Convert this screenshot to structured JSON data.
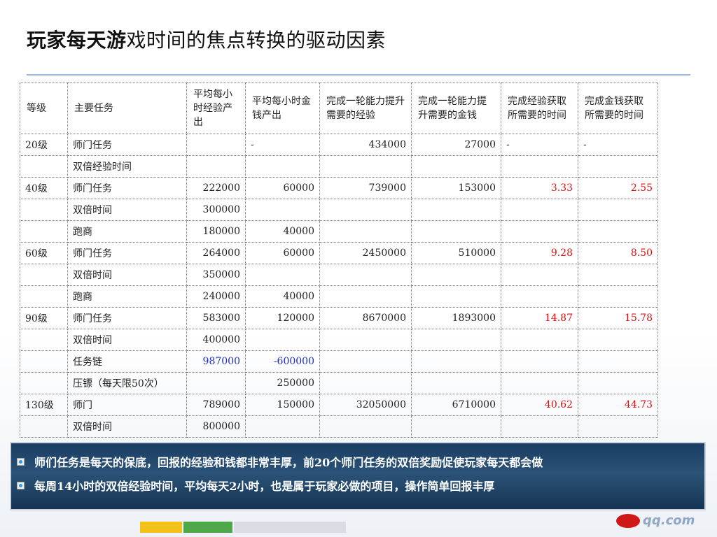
{
  "title": {
    "bold": "玩家每天游",
    "normal": "戏时间的焦点转换的驱动因素"
  },
  "table": {
    "headers": [
      "等级",
      "主要任务",
      "平均每小时经验产出",
      "平均每小时金钱产出",
      "完成一轮能力提升需要的经验",
      "完成一轮能力提升需要的金钱",
      "完成经验获取所需要的时间",
      "完成金钱获取所需要的时间"
    ],
    "rows": [
      {
        "level": "20级",
        "task": "师门任务",
        "exp": "",
        "money": "-",
        "need_exp": "434000",
        "need_money": "27000",
        "t_exp": "-",
        "t_money": "-"
      },
      {
        "level": "",
        "task": "双倍经验时间",
        "exp": "",
        "money": "",
        "need_exp": "",
        "need_money": "",
        "t_exp": "",
        "t_money": ""
      },
      {
        "level": "40级",
        "task": "师门任务",
        "exp": "222000",
        "money": "60000",
        "need_exp": "739000",
        "need_money": "153000",
        "t_exp": "3.33",
        "t_money": "2.55"
      },
      {
        "level": "",
        "task": "双倍时间",
        "exp": "300000",
        "money": "",
        "need_exp": "",
        "need_money": "",
        "t_exp": "",
        "t_money": ""
      },
      {
        "level": "",
        "task": "跑商",
        "exp": "180000",
        "money": "40000",
        "need_exp": "",
        "need_money": "",
        "t_exp": "",
        "t_money": ""
      },
      {
        "level": "60级",
        "task": "师门任务",
        "exp": "264000",
        "money": "60000",
        "need_exp": "2450000",
        "need_money": "510000",
        "t_exp": "9.28",
        "t_money": "8.50"
      },
      {
        "level": "",
        "task": "双倍时间",
        "exp": "350000",
        "money": "",
        "need_exp": "",
        "need_money": "",
        "t_exp": "",
        "t_money": ""
      },
      {
        "level": "",
        "task": "跑商",
        "exp": "240000",
        "money": "40000",
        "need_exp": "",
        "need_money": "",
        "t_exp": "",
        "t_money": ""
      },
      {
        "level": "90级",
        "task": "师门任务",
        "exp": "583000",
        "money": "120000",
        "need_exp": "8670000",
        "need_money": "1893000",
        "t_exp": "14.87",
        "t_money": "15.78"
      },
      {
        "level": "",
        "task": "双倍时间",
        "exp": "400000",
        "money": "",
        "need_exp": "",
        "need_money": "",
        "t_exp": "",
        "t_money": ""
      },
      {
        "level": "",
        "task": "任务链",
        "exp": "987000",
        "money": "-600000",
        "need_exp": "",
        "need_money": "",
        "t_exp": "",
        "t_money": ""
      },
      {
        "level": "",
        "task": "压镖（每天限50次）",
        "exp": "",
        "money": "250000",
        "need_exp": "",
        "need_money": "",
        "t_exp": "",
        "t_money": ""
      },
      {
        "level": "130级",
        "task": "师门",
        "exp": "789000",
        "money": "150000",
        "need_exp": "32050000",
        "need_money": "6710000",
        "t_exp": "40.62",
        "t_money": "44.73"
      },
      {
        "level": "",
        "task": "双倍时间",
        "exp": "800000",
        "money": "",
        "need_exp": "",
        "need_money": "",
        "t_exp": "",
        "t_money": ""
      }
    ]
  },
  "bullets": [
    "师们任务是每天的保底，回报的经验和钱都非常丰厚，前20个师门任务的双倍奖励促使玩家每天都会做",
    "每周14小时的双倍经验时间，平均每天2小时，也是属于玩家必做的项目，操作简单回报丰厚"
  ],
  "logo": {
    "text": "qq.com"
  },
  "colors": {
    "highlight_red": "#e01010",
    "highlight_blue": "#1a2cc9",
    "bullet_panel": "#1a3d62",
    "rule": "#9ab6d8"
  }
}
